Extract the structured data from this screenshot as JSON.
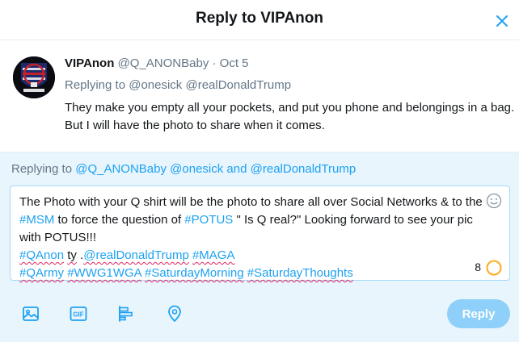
{
  "dialog": {
    "title": "Reply to VIPAnon"
  },
  "original_tweet": {
    "display_name": "VIPAnon",
    "handle": "@Q_ANONBaby",
    "separator": "·",
    "date": "Oct 5",
    "replying_label": "Replying to",
    "replying_mentions": [
      "@onesick",
      "@realDonaldTrump"
    ],
    "text_lines": [
      "They make you empty all your pockets, and put you phone and belongings in a bag.",
      "But I will have the photo to share when it comes."
    ]
  },
  "compose": {
    "replying_label": "Replying to",
    "mentions": [
      "@Q_ANONBaby",
      "@onesick",
      "@realDonaldTrump"
    ],
    "mentions_joiner": "and",
    "draft": {
      "line1": "The Photo with your Q shirt will be the photo to share all over Social Networks & to the",
      "line2_tag1": "#MSM",
      "line2_mid": " to force the question of ",
      "line2_tag2": "#POTUS",
      "line2_end": " \" Is Q real?\"  Looking forward to see your pic",
      "line3": "with POTUS!!!",
      "line4_tag1": "#QAnon",
      "line4_sp1": " ",
      "line4_word": "ty",
      "line4_sp2": " .",
      "line4_mention": "@realDonaldTrump",
      "line4_sp3": " ",
      "line4_tag2": "#MAGA",
      "line5_tag1": "#QArmy",
      "line5_tag2": "#WWG1WGA",
      "line5_tag3": "#SaturdayMorning",
      "line5_tag4": "#SaturdayThoughts"
    },
    "characters_remaining": "8",
    "reply_button_label": "Reply"
  },
  "icons": {
    "close": "close-icon",
    "emoji": "emoji-icon",
    "media": "image-icon",
    "gif": "gif-icon",
    "poll": "poll-icon",
    "location": "location-icon"
  },
  "colors": {
    "accent": "#1da1f2",
    "reply_button_disabled": "#8ed0f9",
    "compose_background": "#e8f5fd",
    "counter_warning": "#ffad1f",
    "spellcheck_underline": "#e0245e"
  }
}
